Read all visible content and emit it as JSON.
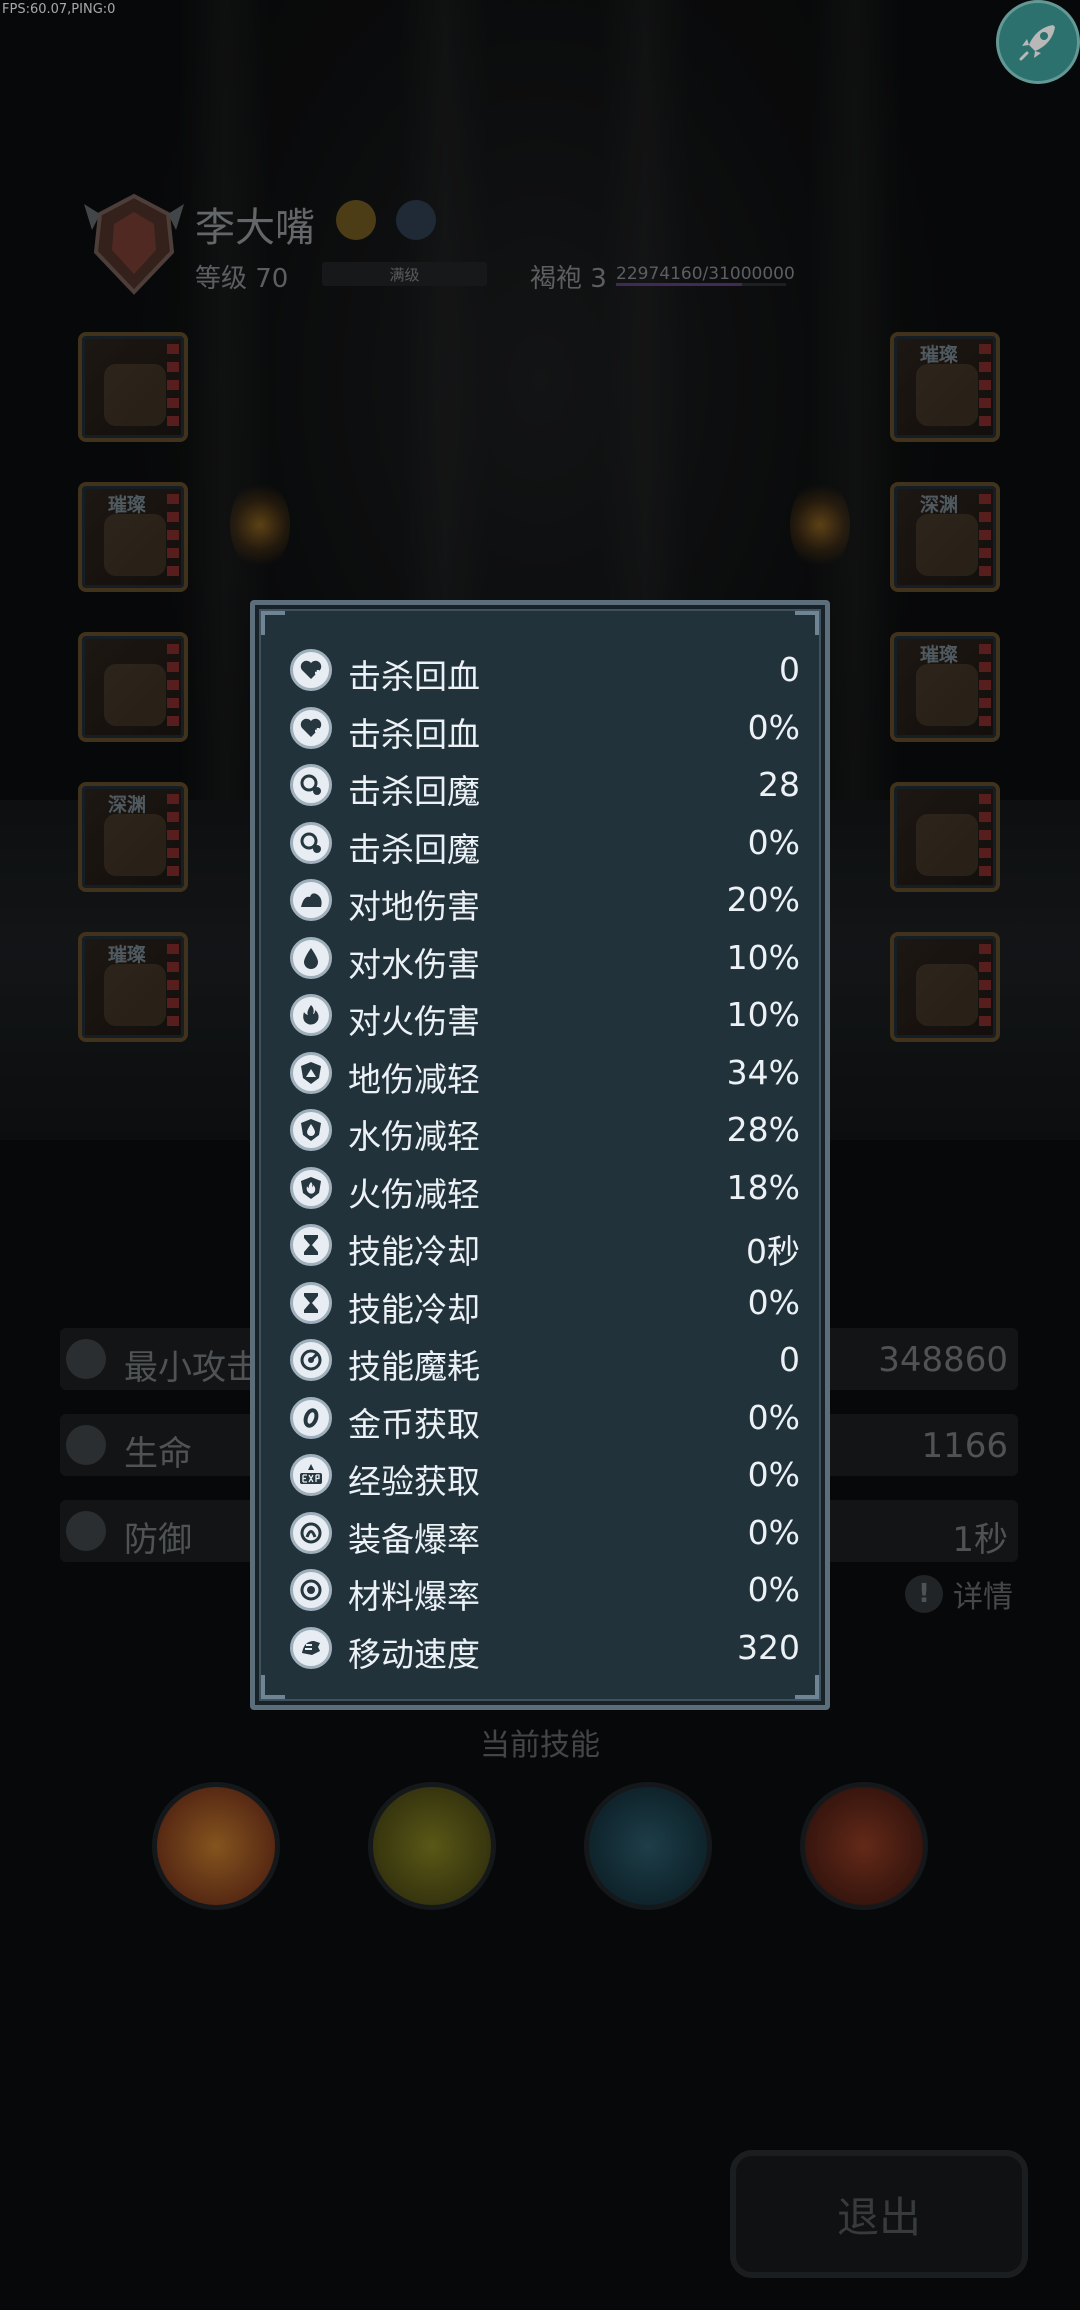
{
  "debug": {
    "fps_text": "FPS:60.07,PING:0"
  },
  "character": {
    "name": "李大嘴",
    "level_label": "等级 70",
    "level_status": "满级",
    "rank_label": "褐袍 3",
    "rank_progress": "22974160/31000000",
    "rank_fill_fraction": 0.741
  },
  "equipment": {
    "left": [
      {
        "tag": ""
      },
      {
        "tag": "璀璨"
      },
      {
        "tag": ""
      },
      {
        "tag": "深渊"
      },
      {
        "tag": "璀璨"
      }
    ],
    "right": [
      {
        "tag": "璀璨"
      },
      {
        "tag": "深渊"
      },
      {
        "tag": "璀璨"
      },
      {
        "tag": ""
      },
      {
        "tag": ""
      }
    ]
  },
  "base_stats": [
    {
      "name": "最小攻击",
      "value": "348860"
    },
    {
      "name": "生命",
      "value": "1166"
    },
    {
      "name": "防御",
      "value": "1秒"
    }
  ],
  "detail_label": "详情",
  "skills_title": "当前技能",
  "exit_label": "退出",
  "popup": {
    "rows": [
      {
        "icon": "heart-plus-icon",
        "name": "击杀回血",
        "value": "0"
      },
      {
        "icon": "heart-plus-icon",
        "name": "击杀回血",
        "value": "0%"
      },
      {
        "icon": "mana-orb-icon",
        "name": "击杀回魔",
        "value": "28"
      },
      {
        "icon": "mana-orb-icon",
        "name": "击杀回魔",
        "value": "0%"
      },
      {
        "icon": "earth-icon",
        "name": "对地伤害",
        "value": "20%"
      },
      {
        "icon": "water-drop-icon",
        "name": "对水伤害",
        "value": "10%"
      },
      {
        "icon": "flame-icon",
        "name": "对火伤害",
        "value": "10%"
      },
      {
        "icon": "earth-shield-icon",
        "name": "地伤减轻",
        "value": "34%"
      },
      {
        "icon": "water-shield-icon",
        "name": "水伤减轻",
        "value": "28%"
      },
      {
        "icon": "fire-shield-icon",
        "name": "火伤减轻",
        "value": "18%"
      },
      {
        "icon": "hourglass-icon",
        "name": "技能冷却",
        "value": "0秒"
      },
      {
        "icon": "hourglass-icon",
        "name": "技能冷却",
        "value": "0%"
      },
      {
        "icon": "mana-cost-icon",
        "name": "技能魔耗",
        "value": "0"
      },
      {
        "icon": "coin-icon",
        "name": "金币获取",
        "value": "0%"
      },
      {
        "icon": "exp-icon",
        "name": "经验获取",
        "value": "0%"
      },
      {
        "icon": "equipment-drop-icon",
        "name": "装备爆率",
        "value": "0%"
      },
      {
        "icon": "material-drop-icon",
        "name": "材料爆率",
        "value": "0%"
      },
      {
        "icon": "speed-icon",
        "name": "移动速度",
        "value": "320"
      }
    ]
  }
}
